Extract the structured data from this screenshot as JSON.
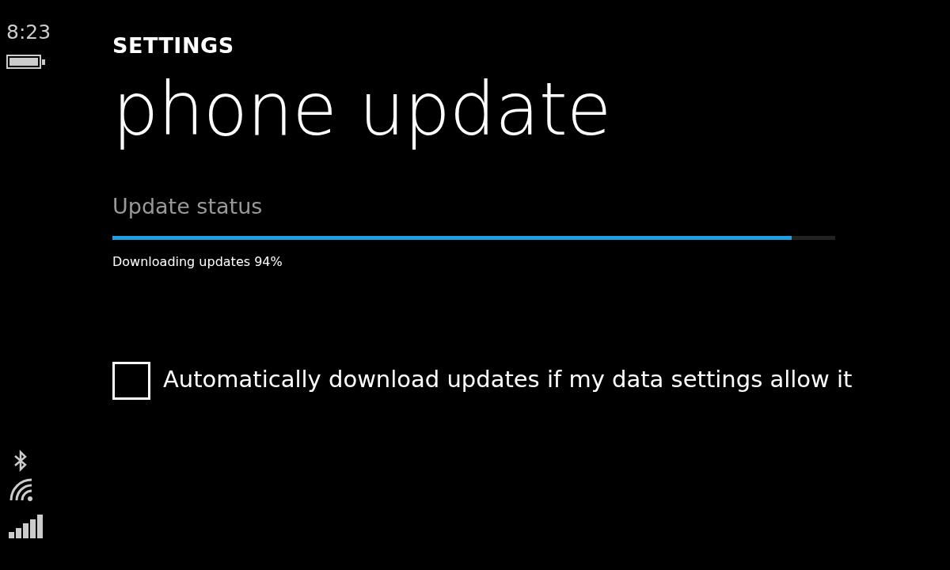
{
  "status_bar": {
    "time": "8:23"
  },
  "header": {
    "app_title": "SETTINGS",
    "page_title": "phone update"
  },
  "update": {
    "label": "Update status",
    "level": 0.94,
    "status_text": "Downloading updates 94%"
  },
  "auto_download": {
    "label": "Automatically download updates if my data settings allow it",
    "checked": false
  }
}
